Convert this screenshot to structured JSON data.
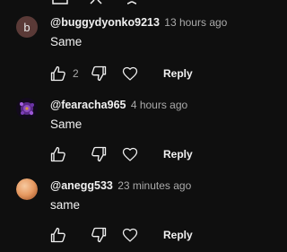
{
  "top_fragment": {
    "icons": [
      "thumb-up-icon",
      "thumb-down-icon",
      "heart-icon"
    ]
  },
  "comments": [
    {
      "avatar_letter": "b",
      "avatar_color": "#5a3a37",
      "handle": "@buggydyonko9213",
      "time": "13 hours ago",
      "text": "Same",
      "likes": "2",
      "reply_label": "Reply"
    },
    {
      "avatar_letter": "",
      "avatar_color": "#3b1f5c",
      "handle": "@fearacha965",
      "time": "4 hours ago",
      "text": "Same",
      "likes": "",
      "reply_label": "Reply"
    },
    {
      "avatar_letter": "",
      "avatar_color": "#e8a070",
      "handle": "@anegg533",
      "time": "23 minutes ago",
      "text": "same",
      "likes": "",
      "reply_label": "Reply"
    }
  ],
  "icons": {
    "like": "thumb-up-icon",
    "dislike": "thumb-down-icon",
    "heart": "heart-icon"
  },
  "colors": {
    "background": "#0f0f0f",
    "text_primary": "#f1f1f1",
    "text_secondary": "#aaaaaa"
  }
}
